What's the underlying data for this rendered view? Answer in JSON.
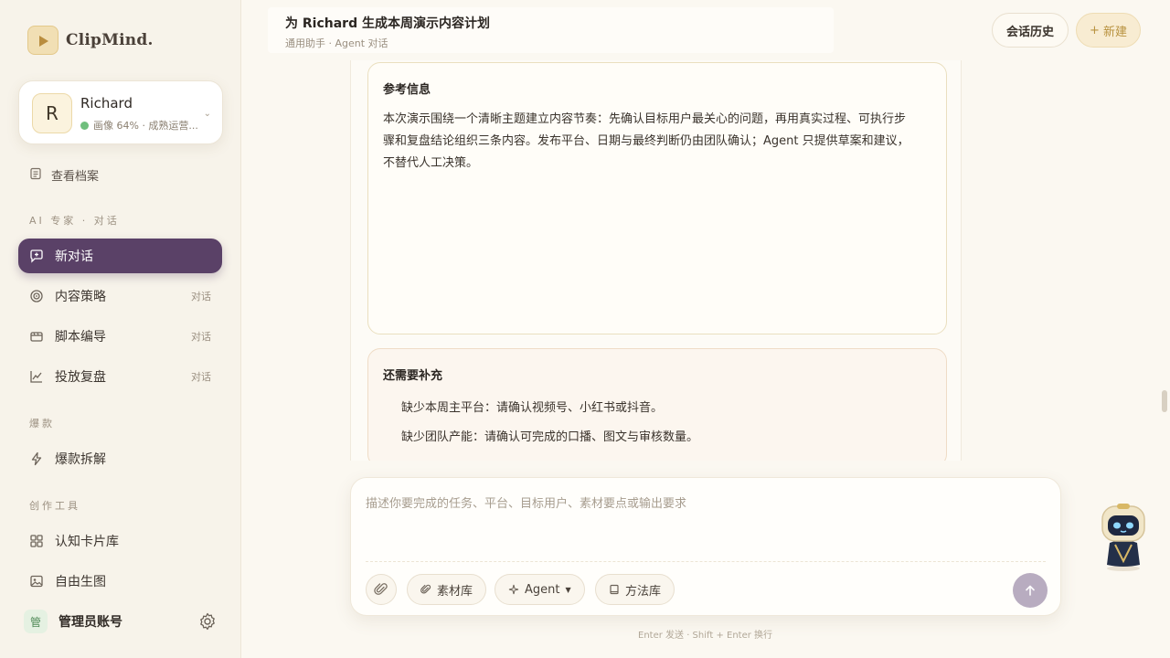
{
  "brand": {
    "name": "ClipMind."
  },
  "profile": {
    "initial": "R",
    "name": "Richard",
    "status": "画像 64% · 成熟运营...",
    "status_color": "#6fbf7d"
  },
  "sidebar": {
    "view_profile": "查看档案",
    "section_ai": "AI 专家 · 对话",
    "items": [
      {
        "label": "新对话",
        "icon": "new-chat-icon",
        "tag": ""
      },
      {
        "label": "内容策略",
        "icon": "target-icon",
        "tag": "对话"
      },
      {
        "label": "脚本编导",
        "icon": "clapper-icon",
        "tag": "对话"
      },
      {
        "label": "投放复盘",
        "icon": "chart-icon",
        "tag": "对话"
      }
    ],
    "section_hot": "爆款",
    "hot_item": {
      "label": "爆款拆解",
      "icon": "lightning-icon"
    },
    "section_tools": "创作工具",
    "tools": [
      {
        "label": "认知卡片库",
        "icon": "grid-icon"
      },
      {
        "label": "自由生图",
        "icon": "image-icon"
      }
    ],
    "account": {
      "badge": "管",
      "name": "管理员账号"
    }
  },
  "header": {
    "title": "为 Richard 生成本周演示内容计划",
    "subtitle": "通用助手 · Agent 对话",
    "history_label": "会话历史",
    "new_label": "新建",
    "new_prefix": "+"
  },
  "messages": {
    "ref_title": "参考信息",
    "ref_body": "本次演示围绕一个清晰主题建立内容节奏：先确认目标用户最关心的问题，再用真实过程、可执行步骤和复盘结论组织三条内容。发布平台、日期与最终判断仍由团队确认；Agent 只提供草案和建议，不替代人工决策。",
    "need_title": "还需要补充",
    "need_items": [
      "缺少本周主平台：请确认视频号、小红书或抖音。",
      "缺少团队产能：请确认可完成的口播、图文与审核数量。"
    ]
  },
  "composer": {
    "placeholder": "描述你要完成的任务、平台、目标用户、素材要点或输出要求",
    "material_label": "素材库",
    "agent_label": "Agent",
    "method_label": "方法库",
    "hint": "Enter 发送 · Shift + Enter 换行"
  },
  "colors": {
    "accent": "#5a4167",
    "gold": "#b8923f",
    "background": "#fbf8f1"
  }
}
